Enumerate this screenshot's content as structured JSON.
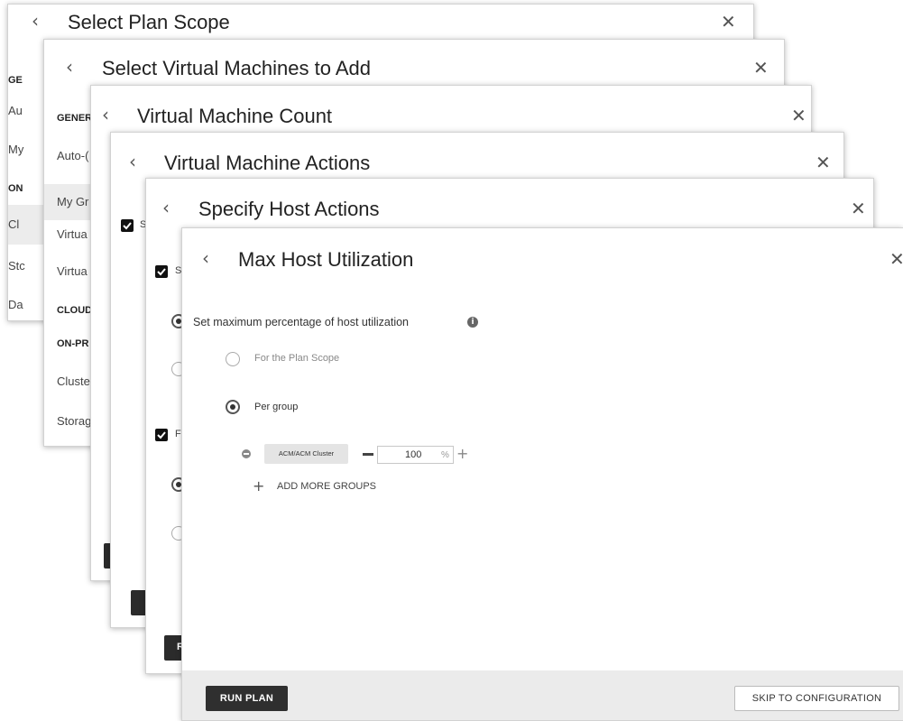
{
  "panel1": {
    "title": "Select Plan Scope",
    "sections": [
      "GE",
      "ON"
    ],
    "items": [
      "Au",
      "My",
      "Cl",
      "Stc",
      "Da"
    ]
  },
  "panel2": {
    "title": "Select Virtual Machines to Add",
    "sections": [
      "GENER",
      "CLOUD",
      "ON-PR"
    ],
    "items": [
      "Auto-(",
      "My Gr",
      "Virtua",
      "Virtua",
      "Cluste",
      "Storag"
    ]
  },
  "panel3": {
    "title": "Virtual Machine Count"
  },
  "panel4": {
    "title": "Virtual Machine Actions",
    "checkbox_label": "S"
  },
  "panel5": {
    "title": "Specify Host Actions",
    "checkbox1_label": "S",
    "checkbox2_label": "F",
    "run_fragment": "R"
  },
  "panel6": {
    "title": "Max Host Utilization",
    "description": "Set maximum percentage of host utilization",
    "options": {
      "plan_scope": "For the Plan Scope",
      "per_group": "Per group"
    },
    "group": {
      "name": "ACM/ACM Cluster",
      "value": "100",
      "unit": "%"
    },
    "add_more": "ADD MORE GROUPS",
    "run_plan": "RUN PLAN",
    "skip": "SKIP TO CONFIGURATION"
  },
  "icons": {
    "back": "‹",
    "close": "✕",
    "info": "i",
    "minus": "−",
    "plus": "+"
  }
}
